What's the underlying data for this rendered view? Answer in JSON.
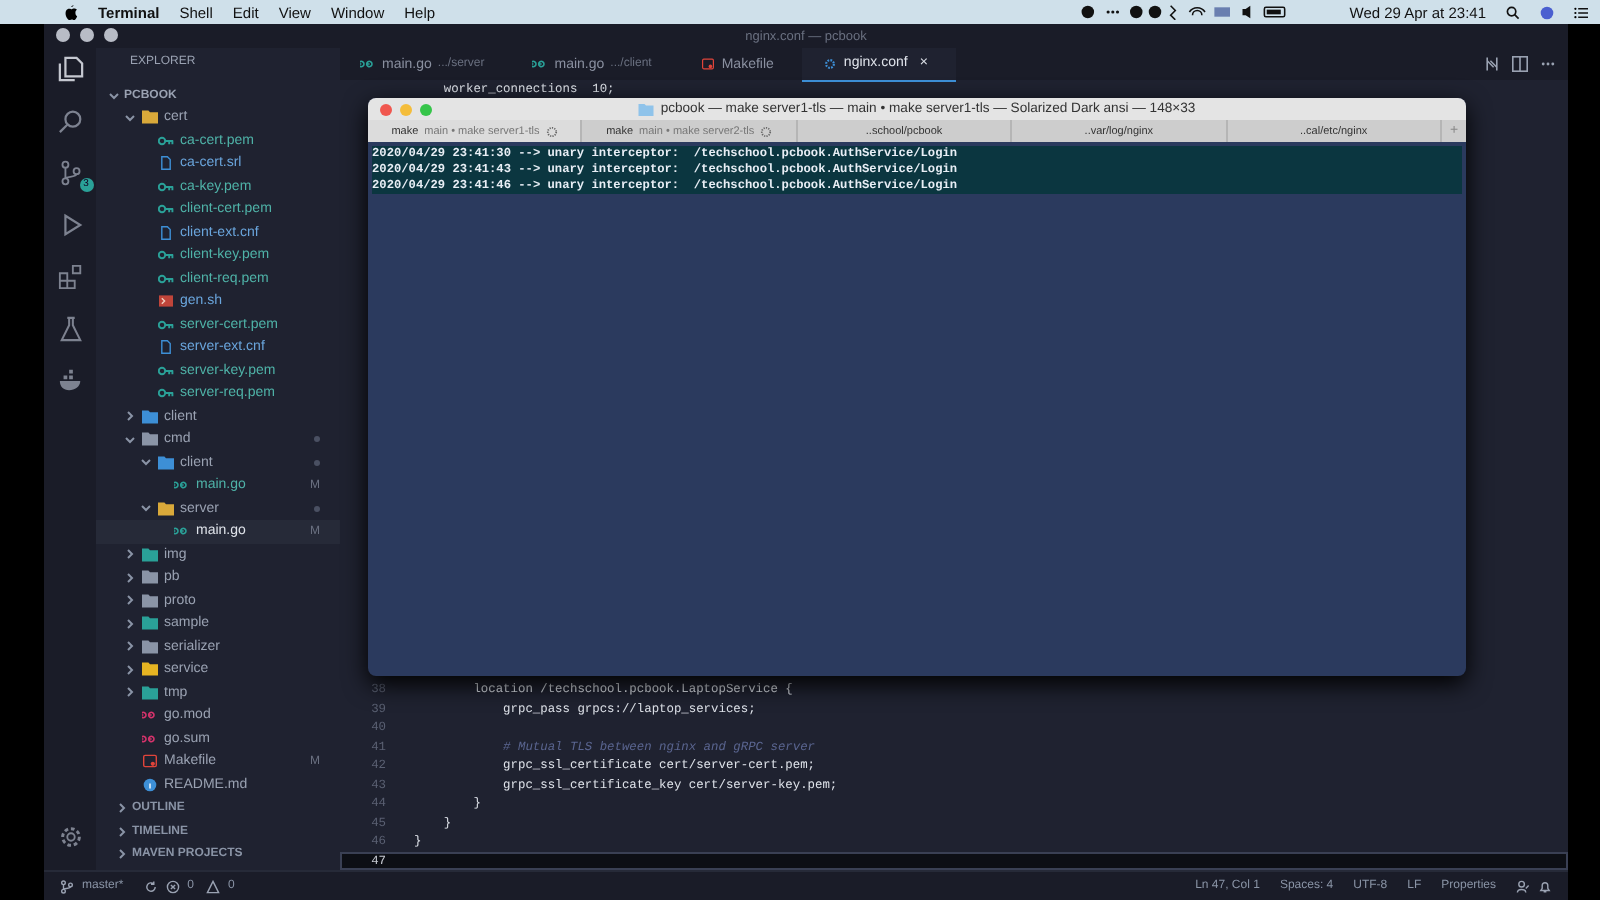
{
  "menu_bar": {
    "app": "Terminal",
    "items": [
      "Shell",
      "Edit",
      "View",
      "Window",
      "Help"
    ],
    "clock": "Wed 29 Apr at 23:41"
  },
  "window": {
    "title": "nginx.conf — pcbook"
  },
  "activity_bar": {
    "source_control_badge": "3"
  },
  "explorer": {
    "title": "EXPLORER",
    "project": "PCBOOK",
    "tree": [
      {
        "label": "cert",
        "kind": "folder",
        "color": "#d9a93a",
        "expanded": true,
        "selected": false,
        "children": [
          {
            "label": "ca-cert.pem",
            "kind": "key",
            "selected": false
          },
          {
            "label": "ca-cert.srl",
            "kind": "doc",
            "selected": false
          },
          {
            "label": "ca-key.pem",
            "kind": "key",
            "selected": false
          },
          {
            "label": "client-cert.pem",
            "kind": "key",
            "selected": false
          },
          {
            "label": "client-ext.cnf",
            "kind": "doc",
            "selected": false
          },
          {
            "label": "client-key.pem",
            "kind": "key",
            "selected": false
          },
          {
            "label": "client-req.pem",
            "kind": "key",
            "selected": false
          },
          {
            "label": "gen.sh",
            "kind": "shell",
            "selected": false
          },
          {
            "label": "server-cert.pem",
            "kind": "key",
            "selected": false
          },
          {
            "label": "server-ext.cnf",
            "kind": "doc",
            "selected": false
          },
          {
            "label": "server-key.pem",
            "kind": "key",
            "selected": false
          },
          {
            "label": "server-req.pem",
            "kind": "key",
            "selected": false
          }
        ]
      },
      {
        "label": "client",
        "kind": "folder",
        "color": "#3d8fd6",
        "expanded": false,
        "selected": false
      },
      {
        "label": "cmd",
        "kind": "folder",
        "color": "#8a94a6",
        "expanded": true,
        "modified": true,
        "selected": false,
        "children": [
          {
            "label": "client",
            "kind": "folder",
            "color": "#3d8fd6",
            "expanded": true,
            "modified": true,
            "selected": false,
            "children": [
              {
                "label": "main.go",
                "kind": "go",
                "badge": "M",
                "selected": false
              }
            ]
          },
          {
            "label": "server",
            "kind": "folder",
            "color": "#d9a93a",
            "expanded": true,
            "modified": true,
            "selected": false,
            "children": [
              {
                "label": "main.go",
                "kind": "go",
                "badge": "M",
                "selected": true
              }
            ]
          }
        ]
      },
      {
        "label": "img",
        "kind": "folder",
        "color": "#2aa198",
        "expanded": false,
        "selected": false
      },
      {
        "label": "pb",
        "kind": "folder",
        "color": "#8a94a6",
        "expanded": false,
        "selected": false
      },
      {
        "label": "proto",
        "kind": "folder",
        "color": "#8a94a6",
        "expanded": false,
        "selected": false
      },
      {
        "label": "sample",
        "kind": "folder",
        "color": "#2aa198",
        "expanded": false,
        "selected": false
      },
      {
        "label": "serializer",
        "kind": "folder",
        "color": "#8a94a6",
        "expanded": false,
        "selected": false
      },
      {
        "label": "service",
        "kind": "folder",
        "color": "#e6b422",
        "expanded": false,
        "selected": false
      },
      {
        "label": "tmp",
        "kind": "folder",
        "color": "#2aa198",
        "expanded": false,
        "selected": false
      },
      {
        "label": "go.mod",
        "kind": "gomod",
        "selected": false
      },
      {
        "label": "go.sum",
        "kind": "gomod",
        "selected": false
      },
      {
        "label": "Makefile",
        "kind": "make",
        "badge": "M",
        "selected": false
      },
      {
        "label": "README.md",
        "kind": "info",
        "selected": false
      }
    ],
    "sections": [
      "OUTLINE",
      "TIMELINE",
      "MAVEN PROJECTS"
    ]
  },
  "editor_tabs": [
    {
      "label": "main.go",
      "path": ".../server",
      "kind": "go",
      "selected": false
    },
    {
      "label": "main.go",
      "path": ".../client",
      "kind": "go",
      "selected": false
    },
    {
      "label": "Makefile",
      "kind": "make",
      "selected": false
    },
    {
      "label": "nginx.conf",
      "kind": "gear",
      "selected": true,
      "close": "×"
    }
  ],
  "editor": {
    "top_line": "    worker_connections  10;",
    "lines": [
      {
        "number": "38",
        "text": "        location /techschool.pcbook.LaptopService {",
        "kind": "code",
        "current": false
      },
      {
        "number": "39",
        "text": "            grpc_pass grpcs://laptop_services;",
        "kind": "code",
        "current": false
      },
      {
        "number": "40",
        "current": false
      },
      {
        "number": "41",
        "text": "            # Mutual TLS between nginx and gRPC server",
        "kind": "comment",
        "current": false
      },
      {
        "number": "42",
        "text": "            grpc_ssl_certificate cert/server-cert.pem;",
        "kind": "code",
        "current": false
      },
      {
        "number": "43",
        "text": "            grpc_ssl_certificate_key cert/server-key.pem;",
        "kind": "code",
        "current": false
      },
      {
        "number": "44",
        "text": "        }",
        "kind": "code",
        "current": false
      },
      {
        "number": "45",
        "text": "    }",
        "kind": "code",
        "current": false
      },
      {
        "number": "46",
        "text": "}",
        "kind": "code",
        "current": false
      },
      {
        "number": "47",
        "current": true
      }
    ]
  },
  "terminal": {
    "title": "pcbook — make server1-tls — main • make server1-tls — Solarized Dark ansi — 148×33",
    "tabs": [
      {
        "label": "make",
        "detail": "main • make server1-tls",
        "busy": true,
        "selected": true
      },
      {
        "label": "make",
        "detail": "main • make server2-tls",
        "busy": true,
        "selected": false
      },
      {
        "label": "..school/pcbook",
        "busy": false,
        "selected": false
      },
      {
        "label": "..var/log/nginx",
        "busy": false,
        "selected": false
      },
      {
        "label": "..cal/etc/nginx",
        "busy": false,
        "selected": false
      }
    ],
    "new_tab": "+",
    "lines": [
      {
        "text": "2020/04/29 23:41:30 --> unary interceptor:  /techschool.pcbook.AuthService/Login",
        "selected": true
      },
      {
        "text": "2020/04/29 23:41:43 --> unary interceptor:  /techschool.pcbook.AuthService/Login",
        "selected": true
      },
      {
        "text": "2020/04/29 23:41:46 --> unary interceptor:  /techschool.pcbook.AuthService/Login",
        "selected": true
      }
    ]
  },
  "status_bar": {
    "branch": "master*",
    "errors": "0",
    "warnings": "0",
    "right": [
      "Ln 47, Col 1",
      "Spaces: 4",
      "UTF-8",
      "LF",
      "Properties"
    ]
  }
}
